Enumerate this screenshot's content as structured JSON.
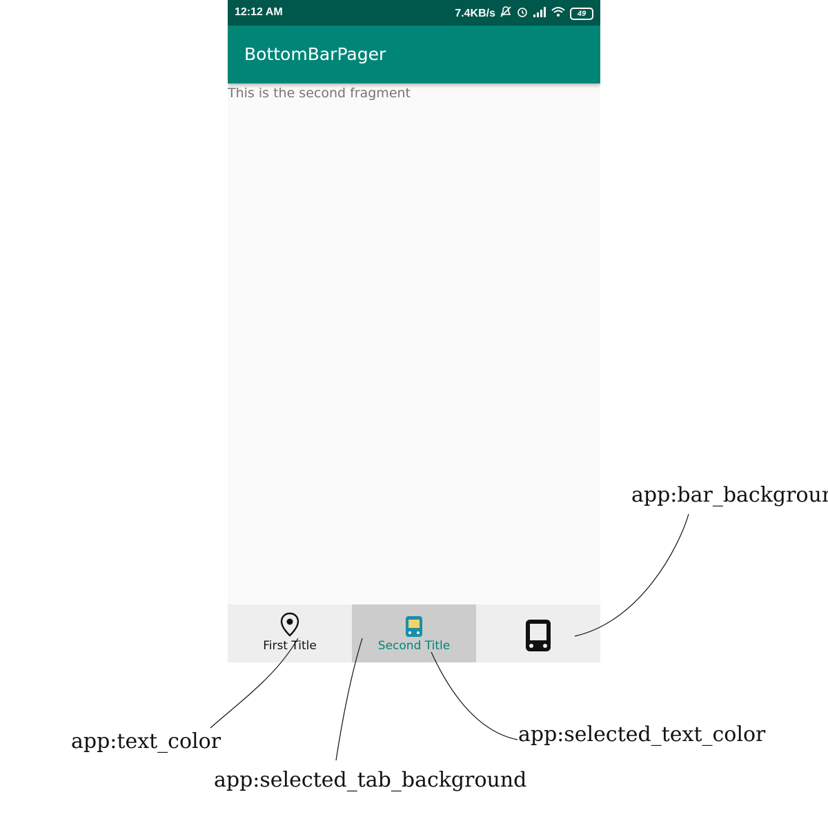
{
  "status_bar": {
    "time": "12:12 AM",
    "net_speed": "7.4KB/s",
    "battery": "49",
    "icons": [
      "bell-off-icon",
      "alarm-icon",
      "signal-icon",
      "wifi-icon",
      "battery-icon"
    ]
  },
  "app_bar": {
    "title": "BottomBarPager"
  },
  "content": {
    "text": "This is the second fragment"
  },
  "bottom_bar": {
    "tabs": [
      {
        "label": "First Title",
        "icon": "map-pin-icon",
        "selected": false
      },
      {
        "label": "Second Title",
        "icon": "tram-icon",
        "selected": true
      },
      {
        "label": "",
        "icon": "tablet-icon",
        "selected": false
      }
    ]
  },
  "annotations": {
    "bar_background": "app:bar_background",
    "text_color": "app:text_color",
    "selected_tab_background": "app:selected_tab_background",
    "selected_text_color": "app:selected_text_color"
  },
  "colors": {
    "status_bar": "#00574b",
    "app_bar": "#008577",
    "content_bg": "#fafafa",
    "bar_background": "#eeeeee",
    "selected_tab_background": "#cccccc",
    "selected_text_color": "#008577",
    "text_color": "#111111"
  }
}
